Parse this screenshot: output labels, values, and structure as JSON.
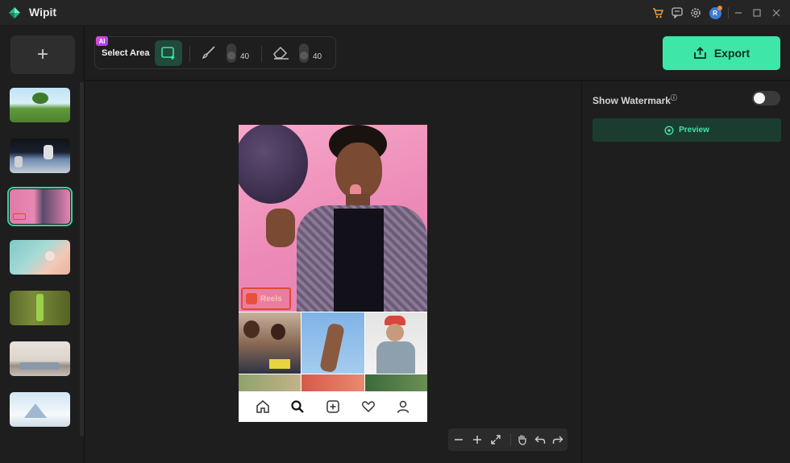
{
  "app": {
    "title": "Wipit"
  },
  "titlebar": {
    "icons": [
      "cart-icon",
      "message-icon",
      "settings-icon",
      "avatar",
      "minimize-icon",
      "maximize-icon",
      "close-icon"
    ],
    "avatar_initial": "R"
  },
  "sidebar": {
    "add_label": "+",
    "thumbnails": [
      {
        "name": "island-landscape",
        "active": false
      },
      {
        "name": "astronaut-space",
        "active": false
      },
      {
        "name": "woman-basketball",
        "active": true
      },
      {
        "name": "floating-food",
        "active": false
      },
      {
        "name": "bottle-in-hand",
        "active": false
      },
      {
        "name": "living-room",
        "active": false
      },
      {
        "name": "snow-mountain",
        "active": false
      }
    ]
  },
  "toolbar": {
    "ai_badge": "AI",
    "select_area_label": "Select Area",
    "brush_size": "40",
    "eraser_size": "40"
  },
  "export": {
    "label": "Export"
  },
  "right_panel": {
    "watermark_label": "Show Watermark",
    "watermark_info": "ⓘ",
    "watermark_enabled": false,
    "preview_label": "Preview"
  },
  "canvas": {
    "reels_label": "Reels"
  },
  "colors": {
    "accent": "#3ee6a7",
    "background": "#1e1e1e",
    "preview_bg": "#1b3d30"
  }
}
